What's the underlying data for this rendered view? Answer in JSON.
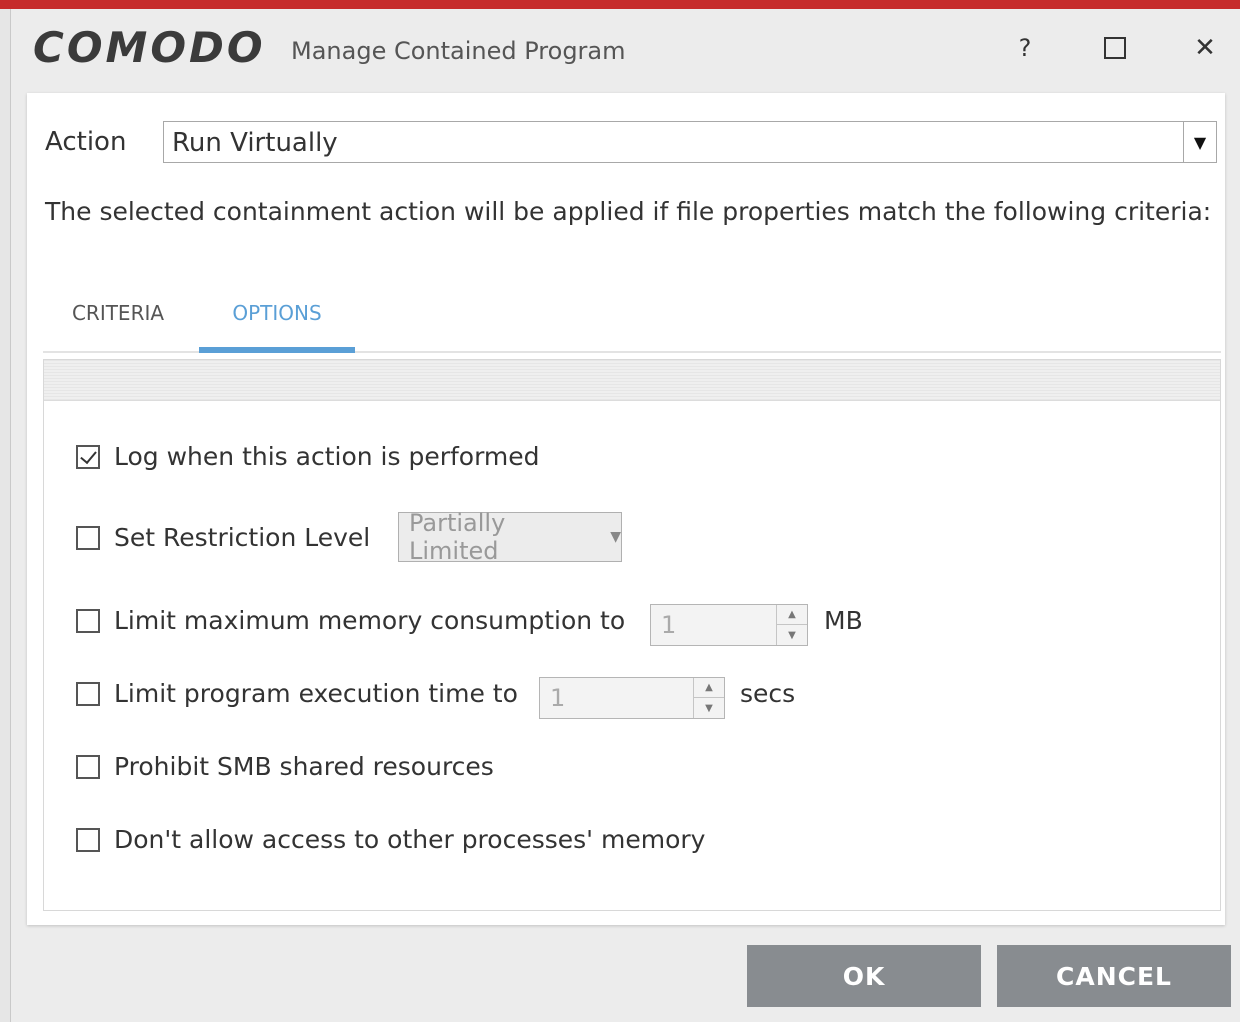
{
  "window": {
    "brand": "COMODO",
    "title": "Manage Contained Program",
    "help_label": "?",
    "close_label": "✕"
  },
  "action": {
    "label": "Action",
    "selected": "Run Virtually"
  },
  "description": "The selected containment action will be applied if file properties match the following criteria:",
  "tabs": [
    {
      "label": "CRITERIA",
      "active": false
    },
    {
      "label": "OPTIONS",
      "active": true
    }
  ],
  "options": {
    "log": {
      "label": "Log when this action is performed",
      "checked": true
    },
    "restriction": {
      "label": "Set Restriction Level",
      "checked": false,
      "value": "Partially Limited"
    },
    "memory": {
      "label": "Limit maximum memory consumption to",
      "checked": false,
      "value": "1",
      "unit": "MB"
    },
    "exec_time": {
      "label": "Limit program execution time to",
      "checked": false,
      "value": "1",
      "unit": "secs"
    },
    "smb": {
      "label": "Prohibit SMB shared resources",
      "checked": false
    },
    "memory_access": {
      "label": "Don't allow access to other processes' memory",
      "checked": false
    }
  },
  "buttons": {
    "ok": "OK",
    "cancel": "CANCEL"
  },
  "colors": {
    "accent_tab": "#5a9fd6",
    "button_bg": "#888c90",
    "top_bar": "#c62b2b"
  }
}
